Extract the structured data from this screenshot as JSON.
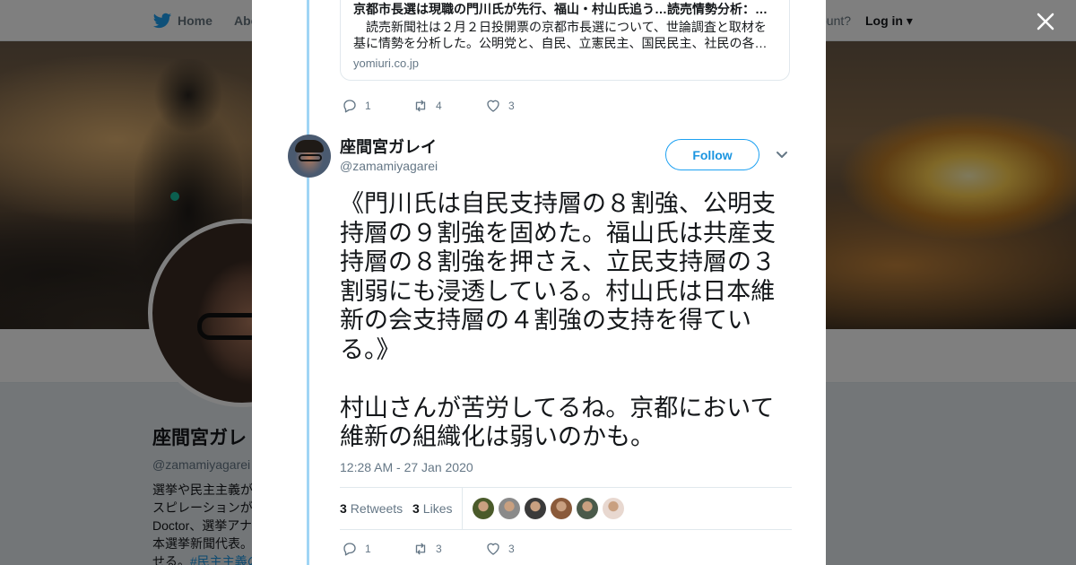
{
  "topbar": {
    "home_label": "Home",
    "about_label": "Abo",
    "account_prompt": "ccount?",
    "login_label": "Log in ▾"
  },
  "profile": {
    "name": "座間宮ガレ",
    "handle": "@zamamiyagarei",
    "bio_lines": [
      "選挙や民主主義が",
      "スピレーションが",
      "Doctor、選挙アナ",
      "本選挙新聞代表。"
    ],
    "bio_last": "せる。",
    "bio_hashtag": "#民主主義の"
  },
  "card": {
    "title": "京都市長選は現職の門川氏が先行、福山・村山氏追う…読売情勢分析：…",
    "description": "　読売新聞社は２月２日投開票の京都市長選について、世論調査と取材を基に情勢を分析した。公明党と、自民、立憲民主、国民民主、社民の各…",
    "domain": "yomiuri.co.jp"
  },
  "prev_actions": {
    "replies": "1",
    "retweets": "4",
    "likes": "3"
  },
  "tweet": {
    "author_name": "座間宮ガレイ",
    "author_handle": "@zamamiyagarei",
    "follow_label": "Follow",
    "text": "《門川氏は自民支持層の８割強、公明支持層の９割強を固めた。福山氏は共産支持層の８割強を押さえ、立民支持層の３割弱にも浸透している。村山氏は日本維新の会支持層の４割強の支持を得ている。》\n\n村山さんが苦労してるね。京都において維新の組織化は弱いのかも。",
    "timestamp": "12:28 AM - 27 Jan 2020",
    "retweet_count": "3",
    "retweet_label": "Retweets",
    "like_count": "3",
    "like_label": "Likes"
  },
  "actions": {
    "replies": "1",
    "retweets": "3",
    "likes": "3"
  },
  "likers": [
    {
      "icon": "liker-avatar",
      "color": "#4a5a2a"
    },
    {
      "icon": "liker-avatar",
      "color": "#8a8a8a"
    },
    {
      "icon": "liker-avatar",
      "color": "#3a3a3a"
    },
    {
      "icon": "liker-avatar",
      "color": "#8a5a3a"
    },
    {
      "icon": "liker-avatar",
      "color": "#4a5a4a"
    },
    {
      "icon": "liker-avatar",
      "color": "#e8d8d0"
    }
  ],
  "colors": {
    "accent": "#1da1f2",
    "link": "#1b95e0",
    "thread": "#9fd5f5",
    "muted": "#657786"
  }
}
